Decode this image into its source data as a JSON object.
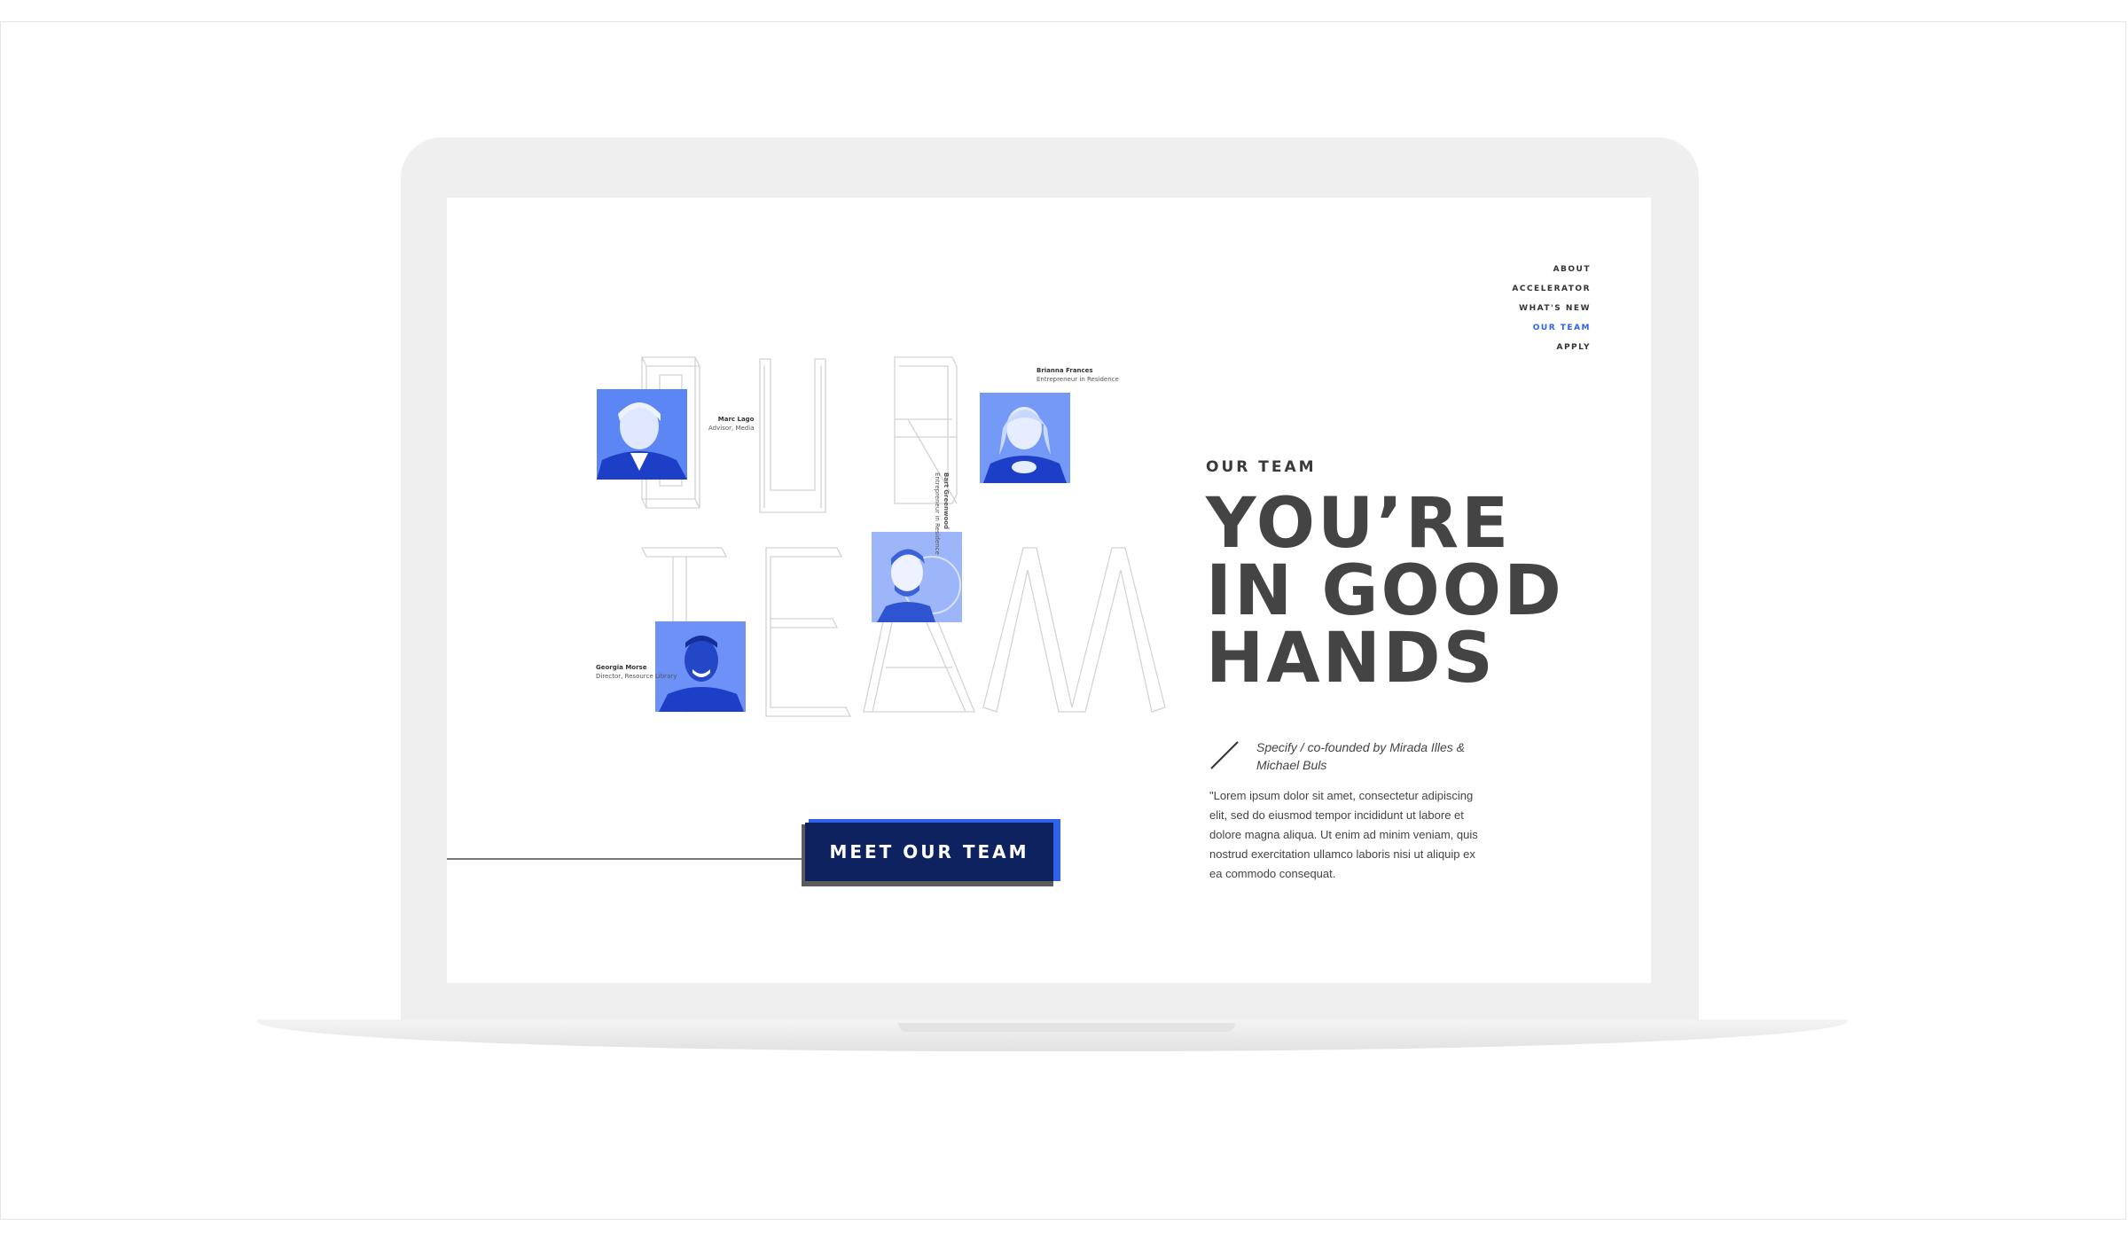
{
  "nav": {
    "items": [
      {
        "label": "ABOUT"
      },
      {
        "label": "ACCELERATOR"
      },
      {
        "label": "WHAT'S NEW"
      },
      {
        "label": "OUR TEAM",
        "active": true
      },
      {
        "label": "APPLY"
      }
    ]
  },
  "team": {
    "people": [
      {
        "name": "Marc Lago",
        "role": "Advisor, Media"
      },
      {
        "name": "Brianna Frances",
        "role": "Entrepreneur in Residence"
      },
      {
        "name": "Bart Greenwood",
        "role": "Entrepreneur in Residence"
      },
      {
        "name": "Georgia Morse",
        "role": "Director,  Resource Library"
      }
    ]
  },
  "hero": {
    "eyebrow": "OUR TEAM",
    "headline": "YOU’RE\nIN GOOD\nHANDS",
    "byline": "Specify /  co-founded by Mirada Illes & Michael Buls",
    "body": "\"Lorem ipsum dolor sit amet, consectetur adipiscing elit, sed do eiusmod tempor incididunt ut labore et dolore magna aliqua. Ut enim ad minim veniam, quis nostrud exercitation ullamco laboris nisi ut aliquip ex ea commodo consequat.",
    "cta": "MEET OUR TEAM"
  },
  "colors": {
    "accent": "#2f62e8",
    "button_bg": "#0f2260",
    "headline": "#444444",
    "photo_tint": "#3b6cf2"
  }
}
